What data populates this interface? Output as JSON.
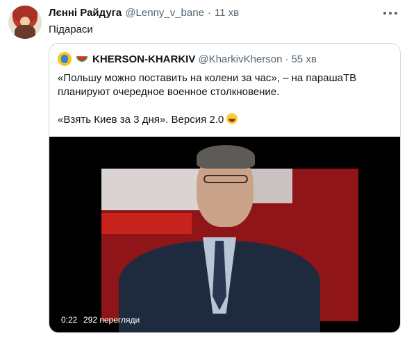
{
  "tweet": {
    "author_name": "Лєнні Райдуга",
    "author_handle": "@Lenny_v_bane",
    "separator": "·",
    "time": "11 хв",
    "text": "Підараси"
  },
  "quoted": {
    "author_name": "KHERSON-KHARKIV",
    "author_handle": "@KharkivKherson",
    "separator": "·",
    "time": "55 хв",
    "text_line1": "«Польшу можно поставить на колени за час», – на парашаТВ",
    "text_line2": "планируют очередное военное столкновение.",
    "text_line3": "«Взять Киев за 3 дня». Версия 2.0"
  },
  "video": {
    "duration": "0:22",
    "views": "292 перегляди"
  },
  "colors": {
    "text": "#0f1419",
    "secondary": "#536471",
    "border": "#cfd9de"
  },
  "icons": {
    "more": "more-dots-icon",
    "watermelon": "watermelon-emoji-icon",
    "laugh": "tears-of-joy-emoji-icon"
  }
}
